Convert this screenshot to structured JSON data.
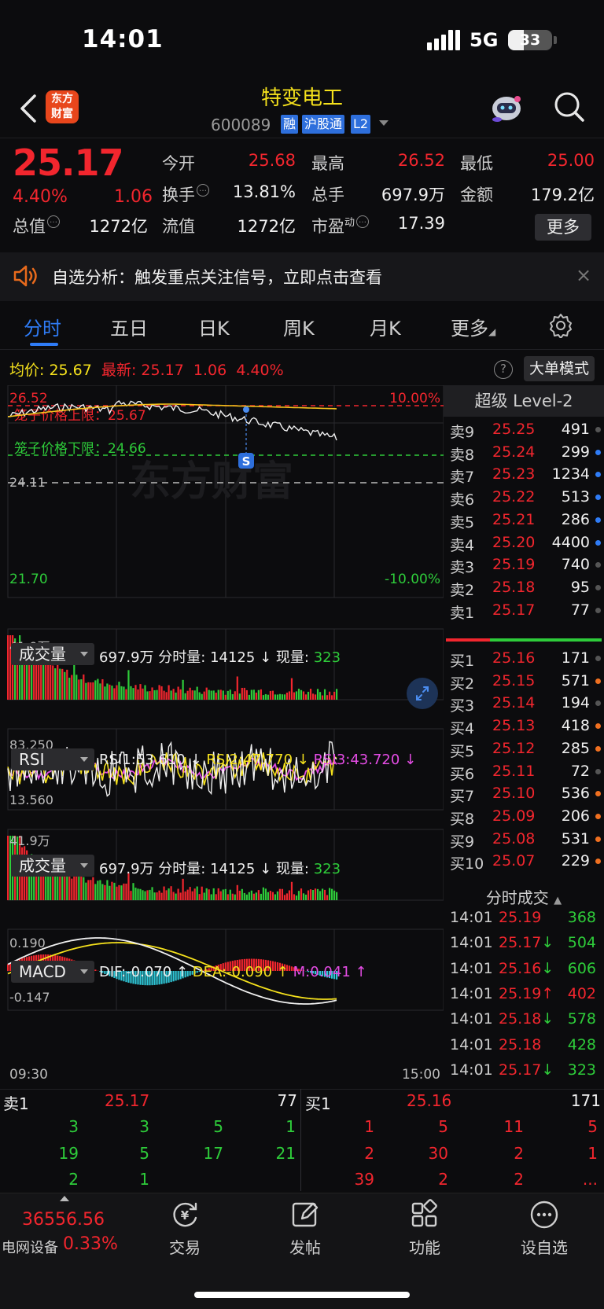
{
  "status_bar": {
    "time": "14:01",
    "network": "5G",
    "battery": "33"
  },
  "header": {
    "back_icon": "chevron-left-icon",
    "logo_text": "东方\n财富",
    "title": "特变电工",
    "code": "600089",
    "tags": [
      "融",
      "沪股通",
      "L2"
    ],
    "robot_icon": "robot-assistant-icon",
    "search_icon": "search-icon"
  },
  "quote": {
    "price": "25.17",
    "change_pct": "4.40%",
    "change": "1.06",
    "fields": [
      {
        "label": "今开",
        "value": "25.68",
        "color": "red"
      },
      {
        "label": "最高",
        "value": "26.52",
        "color": "red"
      },
      {
        "label": "最低",
        "value": "25.00",
        "color": "red"
      },
      {
        "label": "换手",
        "value": "13.81%",
        "color": "white"
      },
      {
        "label": "总手",
        "value": "697.9万",
        "color": "white"
      },
      {
        "label": "金额",
        "value": "179.2亿",
        "color": "white"
      },
      {
        "label": "总值",
        "value": "1272亿",
        "color": "white"
      },
      {
        "label": "流值",
        "value": "1272亿",
        "color": "white"
      },
      {
        "label": "市盈",
        "label_sup": "动",
        "value": "17.39",
        "color": "white"
      }
    ],
    "more_button": "更多"
  },
  "banner": {
    "text": "自选分析：触发重点关注信号，立即点击查看",
    "close": "×"
  },
  "tabs": [
    "分时",
    "五日",
    "日K",
    "周K",
    "月K",
    "更多"
  ],
  "avg_bar": {
    "avg_label": "均价:",
    "avg_value": "25.67",
    "latest_label": "最新:",
    "latest_value": "25.17",
    "change": "1.06",
    "pct": "4.40%",
    "help": "?",
    "big_order_mode": "大单模式"
  },
  "intraday_chart": {
    "y_top": "26.52",
    "y_bottom": "21.70",
    "pct_top": "10.00%",
    "pct_bottom": "-10.00%",
    "prev_close": "24.11",
    "upper_cage_label": "笼子价格上限：25.67",
    "lower_cage_label": "笼子价格下限：24.66",
    "watermark": "东方财富",
    "s_marker": "S"
  },
  "volume_panel_1": {
    "selector": "成交量",
    "total": "697.9万",
    "minute_label": "分时量:",
    "minute_value": "14125",
    "now_label": "现量:",
    "now_value": "323",
    "y_max": "41.9万"
  },
  "rsi_panel": {
    "selector": "RSI",
    "rsi1": "RSI1:53.610",
    "rsi2": "RSI2:47.770",
    "rsi3": "RSI3:43.720",
    "y_max": "83.250",
    "y_min": "13.560"
  },
  "volume_panel_2": {
    "selector": "成交量",
    "total": "697.9万",
    "minute_label": "分时量:",
    "minute_value": "14125",
    "now_label": "现量:",
    "now_value": "323",
    "y_max": "41.9万"
  },
  "macd_panel": {
    "selector": "MACD",
    "dif": "DIF:-0.070",
    "dea": "DEA:-0.090",
    "m": "M:0.041",
    "y_max": "0.190",
    "y_min": "-0.147",
    "time_start": "09:30",
    "time_end": "15:00"
  },
  "level2": {
    "title": "超级 Level-2",
    "asks": [
      {
        "label": "卖9",
        "price": "25.25",
        "vol": "491",
        "dot": "#555"
      },
      {
        "label": "卖8",
        "price": "25.24",
        "vol": "299",
        "dot": "#2f7cf6"
      },
      {
        "label": "卖7",
        "price": "25.23",
        "vol": "1234",
        "dot": "#2f7cf6"
      },
      {
        "label": "卖6",
        "price": "25.22",
        "vol": "513",
        "dot": "#2f7cf6"
      },
      {
        "label": "卖5",
        "price": "25.21",
        "vol": "286",
        "dot": "#2f7cf6"
      },
      {
        "label": "卖4",
        "price": "25.20",
        "vol": "4400",
        "dot": "#2f7cf6"
      },
      {
        "label": "卖3",
        "price": "25.19",
        "vol": "740",
        "dot": "#555"
      },
      {
        "label": "卖2",
        "price": "25.18",
        "vol": "95",
        "dot": "#555"
      },
      {
        "label": "卖1",
        "price": "25.17",
        "vol": "77",
        "dot": "#555"
      }
    ],
    "bids": [
      {
        "label": "买1",
        "price": "25.16",
        "vol": "171",
        "dot": "#555"
      },
      {
        "label": "买2",
        "price": "25.15",
        "vol": "571",
        "dot": "#f07020"
      },
      {
        "label": "买3",
        "price": "25.14",
        "vol": "194",
        "dot": "#555"
      },
      {
        "label": "买4",
        "price": "25.13",
        "vol": "418",
        "dot": "#f07020"
      },
      {
        "label": "买5",
        "price": "25.12",
        "vol": "285",
        "dot": "#f07020"
      },
      {
        "label": "买6",
        "price": "25.11",
        "vol": "72",
        "dot": "#555"
      },
      {
        "label": "买7",
        "price": "25.10",
        "vol": "536",
        "dot": "#f07020"
      },
      {
        "label": "买8",
        "price": "25.09",
        "vol": "206",
        "dot": "#f07020"
      },
      {
        "label": "买9",
        "price": "25.08",
        "vol": "531",
        "dot": "#f07020"
      },
      {
        "label": "买10",
        "price": "25.07",
        "vol": "229",
        "dot": "#f07020"
      }
    ],
    "ticks_title": "分时成交",
    "ticks": [
      {
        "time": "14:01",
        "price": "25.19",
        "dir": "",
        "vol": "368",
        "color": "green"
      },
      {
        "time": "14:01",
        "price": "25.17",
        "dir": "↓",
        "vol": "504",
        "color": "green"
      },
      {
        "time": "14:01",
        "price": "25.16",
        "dir": "↓",
        "vol": "606",
        "color": "green"
      },
      {
        "time": "14:01",
        "price": "25.19",
        "dir": "↑",
        "vol": "402",
        "color": "red"
      },
      {
        "time": "14:01",
        "price": "25.18",
        "dir": "↓",
        "vol": "578",
        "color": "green"
      },
      {
        "time": "14:01",
        "price": "25.18",
        "dir": "",
        "vol": "428",
        "color": "green"
      },
      {
        "time": "14:01",
        "price": "25.17",
        "dir": "↓",
        "vol": "323",
        "color": "green"
      }
    ]
  },
  "queue": {
    "sell_label": "卖1",
    "sell_price": "25.17",
    "sell_total": "77",
    "buy_label": "买1",
    "buy_price": "25.16",
    "buy_total": "171",
    "sell_rows": [
      [
        "3",
        "3",
        "5",
        "1"
      ],
      [
        "19",
        "5",
        "17",
        "21"
      ],
      [
        "2",
        "1",
        "",
        ""
      ]
    ],
    "buy_rows": [
      [
        "1",
        "5",
        "11",
        "5"
      ],
      [
        "2",
        "30",
        "2",
        "1"
      ],
      [
        "39",
        "2",
        "2",
        "..."
      ]
    ]
  },
  "bottom_bar": {
    "index_value": "36556.56",
    "index_name": "电网设备",
    "index_pct": "0.33%",
    "items": [
      {
        "label": "交易",
        "icon": "trade-yen-icon"
      },
      {
        "label": "发帖",
        "icon": "edit-post-icon"
      },
      {
        "label": "功能",
        "icon": "apps-grid-icon"
      },
      {
        "label": "设自选",
        "icon": "more-dots-icon"
      }
    ]
  }
}
